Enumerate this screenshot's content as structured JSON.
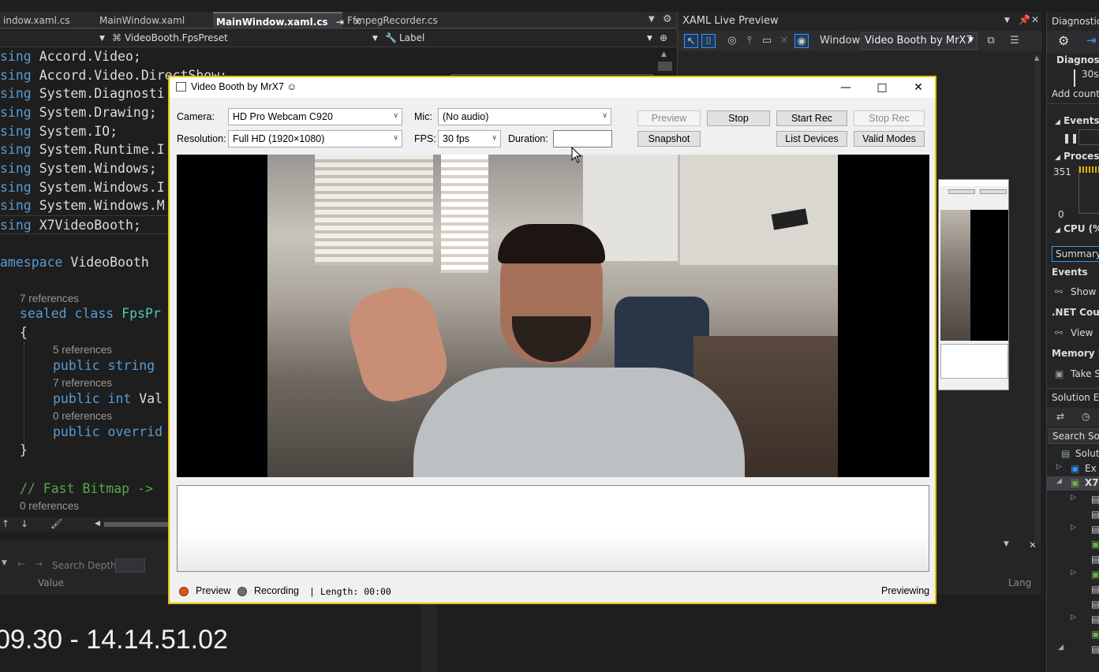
{
  "vs": {
    "tabs": [
      {
        "label": "indow.xaml.cs"
      },
      {
        "label": "MainWindow.xaml"
      },
      {
        "label": "MainWindow.xaml.cs"
      },
      {
        "label": "FfmpegRecorder.cs"
      }
    ],
    "nav": {
      "member": "VideoBooth.FpsPreset",
      "field": "Label"
    },
    "code": {
      "using_kw": "sing",
      "usings": [
        "Accord.Video;",
        "Accord.Video.DirectShow;",
        "System.Diagnosti",
        "System.Drawing;",
        "System.IO;",
        "System.Runtime.I",
        "System.Windows;",
        "System.Windows.I",
        "System.Windows.M",
        "X7VideoBooth;"
      ],
      "namespace_kw": "amespace",
      "namespace_name": "VideoBooth",
      "refs": [
        "7 references",
        "5 references",
        "7 references",
        "0 references",
        "0 references"
      ],
      "class_kw": "sealed class",
      "class_name": "FpsPr",
      "open_brace": "{",
      "close_brace": "}",
      "member1_kw": "public string",
      "member2_kw": "public int",
      "member2_name": "Val",
      "member3_kw": "public overrid",
      "comment": "// Fast Bitmap ->"
    },
    "bottom": {
      "search_depth": "Search Depth:",
      "value_col": "Value",
      "lang_col": "Lang"
    },
    "timestamp": "09.30 - 14.14.51.02"
  },
  "xaml_preview": {
    "title": "XAML Live Preview",
    "window_label": "Window:",
    "window_value": "Video Booth by MrX7 ☺"
  },
  "diagnostics": {
    "title": "Diagnostic",
    "header": "Diagnostic",
    "time": "30s",
    "add_counter": "Add counte",
    "events": "Events",
    "process": "Process M",
    "mem_max": "351",
    "mem_min": "0",
    "cpu": "CPU (% o",
    "summary_tab": "Summary",
    "events2": "Events",
    "show": "Show",
    "net_counters": ".NET Coun",
    "view": "View",
    "memory_usage": "Memory U",
    "take": "Take S",
    "solution_explorer": "Solution Ex",
    "search_solution": "Search Solu",
    "solution_item": "Solutio",
    "tree_items": [
      "Ex",
      "X7"
    ]
  },
  "app": {
    "title": "Video Booth by MrX7 ☺",
    "camera_label": "Camera:",
    "camera_value": "HD Pro Webcam C920",
    "mic_label": "Mic:",
    "mic_value": "(No audio)",
    "resolution_label": "Resolution:",
    "resolution_value": "Full HD (1920×1080)",
    "fps_label": "FPS:",
    "fps_value": "30 fps",
    "duration_label": "Duration:",
    "duration_value": "",
    "buttons": {
      "preview": "Preview",
      "stop": "Stop",
      "start_rec": "Start Rec",
      "stop_rec": "Stop Rec",
      "snapshot": "Snapshot",
      "list_devices": "List Devices",
      "valid_modes": "Valid Modes"
    },
    "status": {
      "preview_label": "Preview",
      "recording_label": "Recording",
      "length": "| Length: 00:00",
      "state": "Previewing",
      "preview_color": "#d9541e",
      "recording_color": "#6d6d6d"
    }
  }
}
